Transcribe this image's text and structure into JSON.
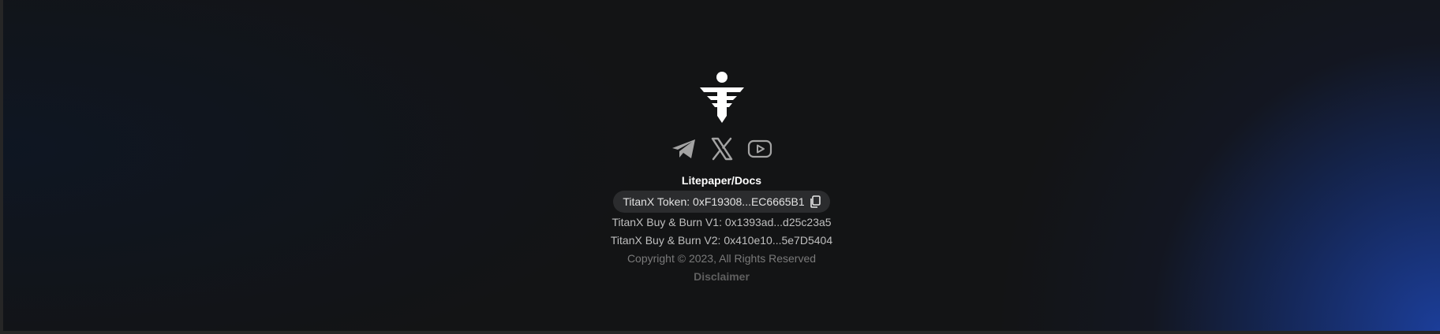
{
  "footer": {
    "logo_icon": "titanx-logo-icon",
    "socials": [
      {
        "icon": "telegram-icon"
      },
      {
        "icon": "x-icon"
      },
      {
        "icon": "youtube-icon"
      }
    ],
    "docs_label": "Litepaper/Docs",
    "token_label": "TitanX Token: 0xF19308...EC6665B1",
    "token_copy_icon": "copy-icon",
    "buy_burn_v1": "TitanX Buy & Burn V1: 0x1393ad...d25c23a5",
    "buy_burn_v2": "TitanX Buy & Burn V2: 0x410e10...5e7D5404",
    "copyright": "Copyright © 2023, All Rights Reserved",
    "disclaimer": "Disclaimer"
  },
  "colors": {
    "background": "#131415",
    "accent_blue": "#1c40a0",
    "pill_bg": "#2b2c2e",
    "icon_gray": "#a3a3a3"
  }
}
